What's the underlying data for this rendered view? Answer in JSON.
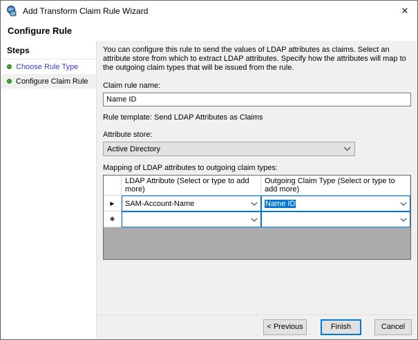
{
  "window": {
    "title": "Add Transform Claim Rule Wizard",
    "close_glyph": "✕"
  },
  "page": {
    "title": "Configure Rule"
  },
  "sidebar": {
    "title": "Steps",
    "items": [
      {
        "label": "Choose Rule Type",
        "state": "completed"
      },
      {
        "label": "Configure Claim Rule",
        "state": "current"
      }
    ]
  },
  "content": {
    "description": "You can configure this rule to send the values of LDAP attributes as claims. Select an attribute store from which to extract LDAP attributes. Specify how the attributes will map to the outgoing claim types that will be issued from the rule.",
    "claim_rule_name": {
      "label": "Claim rule name:",
      "value": "Name ID"
    },
    "rule_template": "Rule template: Send LDAP Attributes as Claims",
    "attribute_store": {
      "label": "Attribute store:",
      "value": "Active Directory"
    },
    "mapping": {
      "label": "Mapping of LDAP attributes to outgoing claim types:",
      "columns": [
        "LDAP Attribute (Select or type to add more)",
        "Outgoing Claim Type (Select or type to add more)"
      ],
      "rows": [
        {
          "selector_glyph": "▶",
          "ldap_attribute": "SAM-Account-Name",
          "outgoing_claim_type": "Name ID",
          "outgoing_selected": true
        },
        {
          "selector_glyph": "✱",
          "ldap_attribute": "",
          "outgoing_claim_type": ""
        }
      ]
    }
  },
  "footer": {
    "previous_label": "< Previous",
    "finish_label": "Finish",
    "cancel_label": "Cancel"
  },
  "colors": {
    "accent_blue": "#0078d7",
    "link_blue": "#3a3ad1",
    "step_green": "#3fae2a",
    "table_empty_gray": "#ababab"
  }
}
